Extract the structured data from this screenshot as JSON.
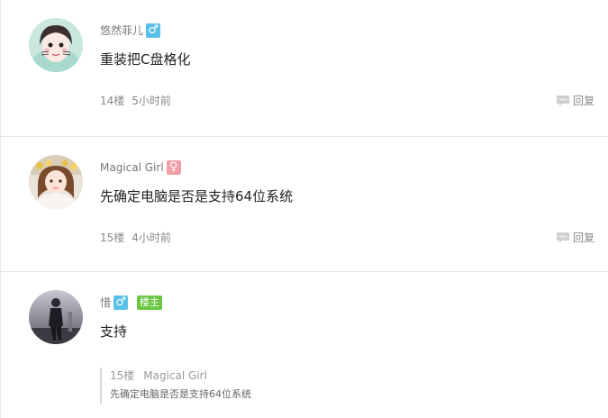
{
  "comments": [
    {
      "username": "悠然菲儿",
      "gender_symbol": "♂",
      "gender": "male",
      "content": "重装把C盘格化",
      "floor": "14楼",
      "time": "5小时前",
      "reply_label": "回复"
    },
    {
      "username": "Magical Girl",
      "gender_symbol": "♀",
      "gender": "female",
      "content": "先确定电脑是否是支持64位系统",
      "floor": "15楼",
      "time": "4小时前",
      "reply_label": "回复"
    },
    {
      "username": "惜",
      "gender_symbol": "♂",
      "gender": "male",
      "owner_badge": "楼主",
      "content": "支持",
      "quote": {
        "floor": "15楼",
        "username": "Magical Girl",
        "text": "先确定电脑是否是支持64位系统"
      }
    }
  ],
  "colors": {
    "male": "#5bc0e8",
    "female": "#f29ea6",
    "owner_badge": "#6cc644"
  },
  "icons": {
    "reply": "speech-bubble-icon"
  }
}
